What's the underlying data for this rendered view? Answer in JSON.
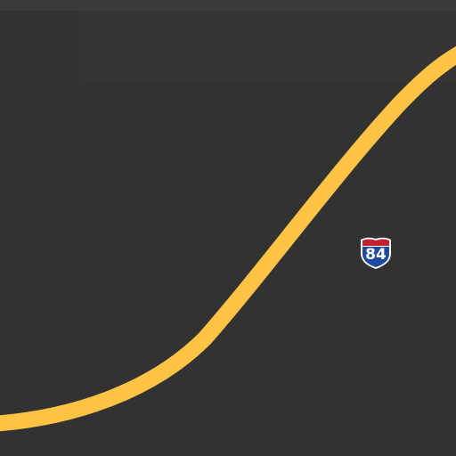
{
  "map": {
    "background_color": "#323232",
    "tile_seam_color": "#3a3a3a",
    "road_color": "#ffc445",
    "road_type": "highway"
  },
  "route_shield": {
    "type": "interstate",
    "number": "84",
    "icon": "interstate-shield-icon",
    "top_color": "#c0202f",
    "body_color": "#1f4aa0",
    "outline_color": "#ffffff",
    "text_color": "#ffffff"
  }
}
